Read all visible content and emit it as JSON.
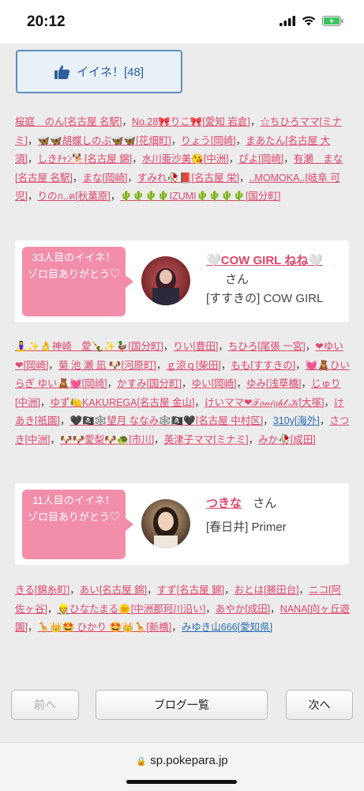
{
  "status": {
    "time": "20:12"
  },
  "like_button": {
    "label": "イイネ！[48]"
  },
  "list1": [
    "桜庭　のん[名古屋 名駅]",
    "No.28🎀りこ🎀[愛知 岩倉]",
    "☆ちひろママ[ミナミ]",
    "🦋🦋胡蝶しのぶ🦋🦋[花畑町]",
    "りょう[岡崎]",
    "まあたん[名古屋 大須]",
    "しきﾁｬﾝ🐕[名古屋 錦]",
    "水川亜沙美😘[中洲]",
    "ぴよ[岡崎]",
    "有瀬　まな[名古屋 名駅]",
    "まな[岡崎]",
    "すみれ🥀📕[名古屋 栄]",
    "..MOMOKA..[岐阜 可児]",
    "りのก..ค[秋葉原]",
    "🌵🌵🌵🌵IZUMI🌵🌵🌵🌵[国分町]"
  ],
  "card1": {
    "badge": "33人目のイイネ！\nゾロ目ありがとう♡",
    "name": "🤍COW GIRL ねね🤍",
    "honorific": "さん",
    "shop": "[すすきの] COW GIRL"
  },
  "list2": [
    "🧘‍♀️✨👌神崎　愛🍾✨🦆[国分町]",
    "りい[豊田]",
    "ちひろ[尾張 一宮]",
    "❤ゆい❤[岡崎]",
    "菊 池 瀬 凪 🐶[河原町]",
    "ｇ涼ｑ[柴田]",
    "もも[すすきの]",
    "💓🧸ひいらぎ ゆい🧸💓[岡崎]",
    "かすみ[国分町]",
    "ゆい[岡崎]",
    "ゆみ[浅草橋]",
    "じゅり[中洲]",
    "ゆず🍋KAKUREGA[名古屋 金山]",
    "けいママ❤𝒯𝑜𝓃𝒾𝑔𝒽𝓉.𝒦[大塚]",
    "けあき[祇園]",
    "🖤🏴‍☠️🕸️望月 ななみ🕸️🏴‍☠️🖤[名古屋 中村区]",
    "310y[海外]",
    "さつき[中洲]",
    "🐶🐶愛梨🐶🐢[市川]",
    "英津子ママ[ミナミ]",
    "みか🥀[成田]"
  ],
  "card2": {
    "badge": "11人目のイイネ！\nゾロ目ありがとう♡",
    "name": "つきな",
    "honorific": "さん",
    "shop": "[春日井] Primer"
  },
  "list3": [
    "きる[錦糸町]",
    "あい[名古屋 錦]",
    "すず[名古屋 錦]",
    "おとは[勝田台]",
    "ニコ[阿佐ヶ谷]",
    "👷ひなたまる🌞[中洲那珂川沿い]",
    "あやか[成田]",
    "NANA[向ヶ丘遊園]",
    "🦒👑🤩 ひかり 🤩👑🦒[新橋]",
    "みゆき山666[愛知県]"
  ],
  "pager": {
    "prev": "前へ",
    "list": "ブログ一覧",
    "next": "次へ"
  },
  "browser": {
    "url": "sp.pokepara.jp"
  },
  "colors": {
    "link": "#e0456b",
    "badge": "#f28eaa",
    "like_border": "#5b8fbe"
  }
}
